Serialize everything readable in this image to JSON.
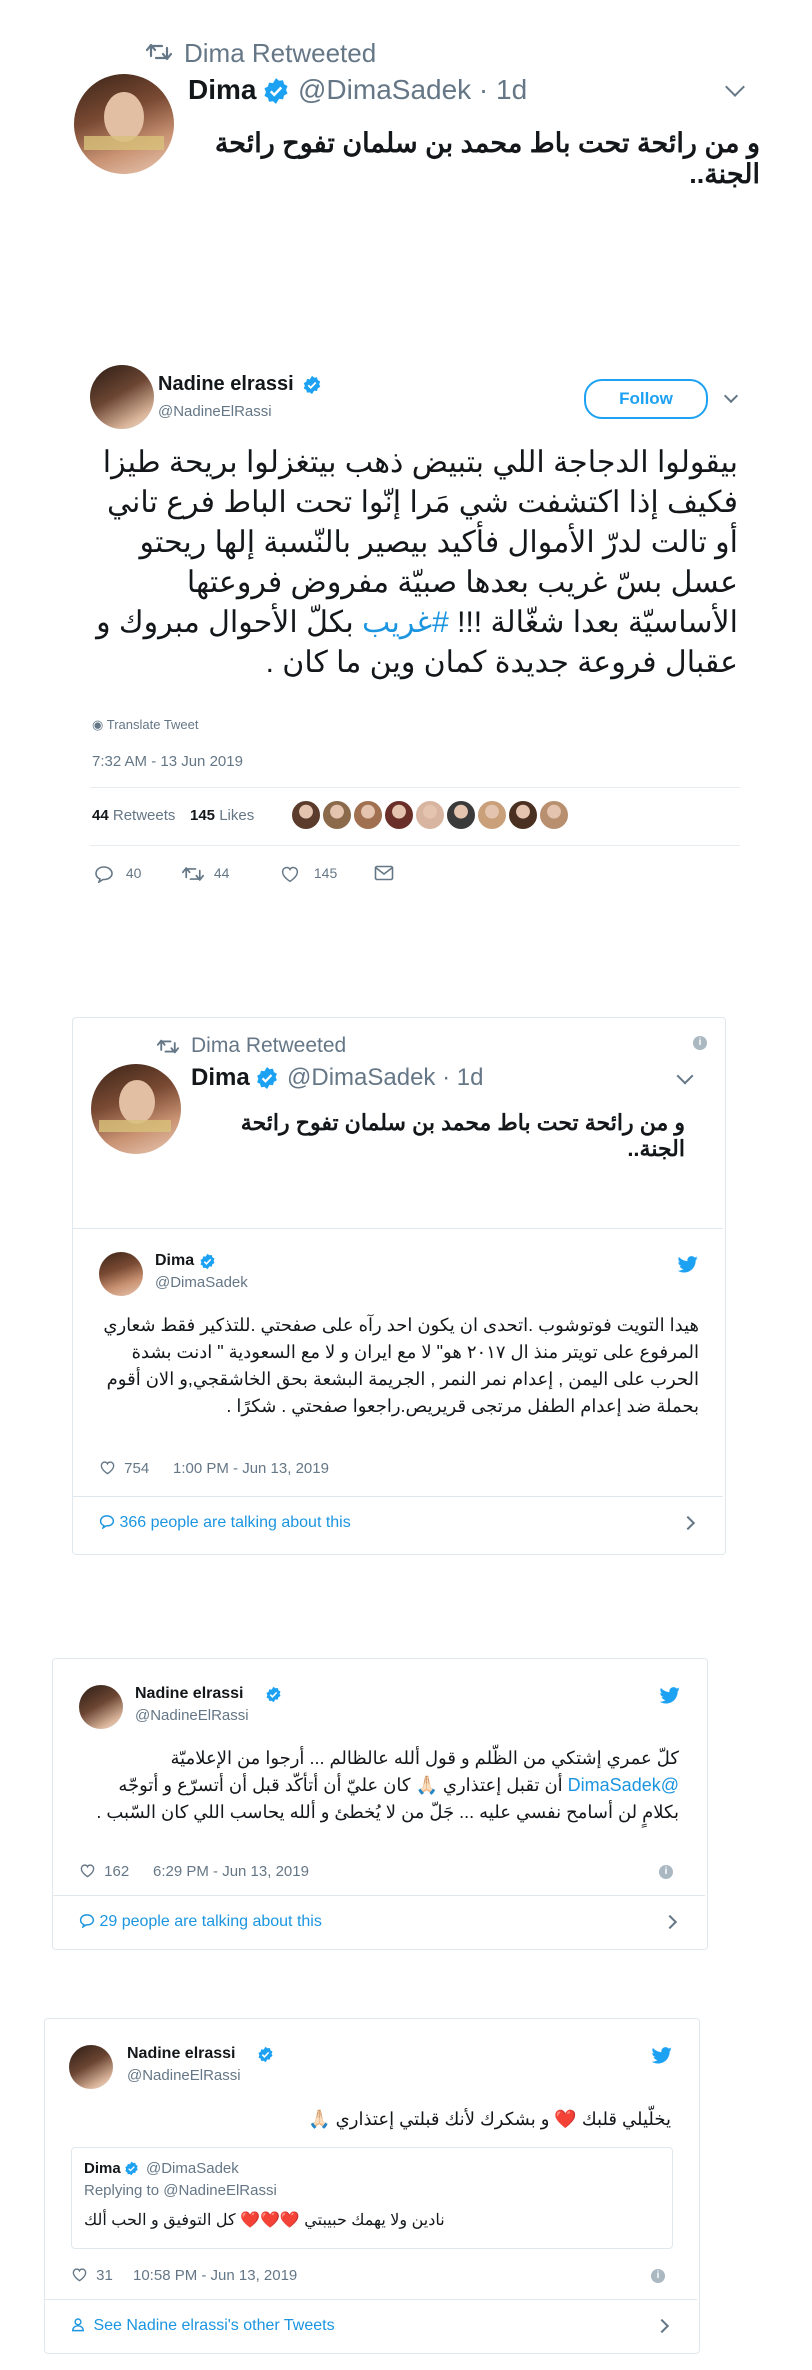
{
  "retweet1": {
    "retweeted_label": "Dima Retweeted",
    "name": "Dima",
    "handle_time": "@DimaSadek · 1d",
    "text": "و من رائحة تحت باط محمد بن سلمان تفوح رائحة الجنة.."
  },
  "tweet1": {
    "name": "Nadine elrassi",
    "handle": "@NadineElRassi",
    "follow_label": "Follow",
    "text_before_tag": "بيقولوا الدجاجة اللي بتبيض ذهب بيتغزلوا بريحة طيزا فكيف إذا اكتشفت شي مَرا إنّوا تحت الباط فرع تاني أو تالت لدرّ الأموال فأكيد بيصير بالنّسبة إلها ريحتو عسل بسّ غريب بعدها صبيّة مفروض فروعتها الأساسيّة بعدا شغّالة !!! ",
    "hashtag": "#غريب",
    "text_after_tag": " بكلّ الأحوال مبروك و عقبال فروعة جديدة كمان وين ما كان .",
    "translate": "Translate Tweet",
    "timestamp": "7:32 AM - 13 Jun 2019",
    "retweets_count": "44",
    "retweets_label": "Retweets",
    "likes_count": "145",
    "likes_label": "Likes",
    "replies": "40",
    "retweets": "44",
    "likes": "145",
    "liker_colors": [
      "#5a3b2c",
      "#8a6a4a",
      "#a07050",
      "#6b2f2a",
      "#d8b5a0",
      "#3a3a3a",
      "#c9a07a",
      "#4a3020",
      "#b89070"
    ]
  },
  "embed1": {
    "retweet": {
      "retweeted_label": "Dima Retweeted",
      "name": "Dima",
      "handle_time": "@DimaSadek · 1d",
      "text": "و من رائحة تحت باط محمد بن سلمان تفوح رائحة الجنة.."
    },
    "name": "Dima",
    "handle": "@DimaSadek",
    "text": "هيدا التويت فوتوشوب .اتحدى ان يكون احد رآه على صفحتي .للتذكير فقط شعاري المرفوع على تويتر منذ ال ٢٠١٧ هو\" لا مع ايران و لا مع السعودية \" ادنت بشدة الحرب على اليمن , إعدام نمر النمر , الجريمة البشعة بحق الخاشقجي,و الان أقوم بحملة ضد إعدام الطفل مرتجى قريريص.راجعوا صفحتي . شكرًا .",
    "likes": "754",
    "timestamp": "1:00 PM - Jun 13, 2019",
    "talking": "366 people are talking about this"
  },
  "embed2": {
    "name": "Nadine elrassi",
    "handle": "@NadineElRassi",
    "text_part1": "كلّ عمري إشتكي من الظّلم و قول ألله عالظالم ... أرجوا من الإعلاميّة ",
    "mention": "@DimaSadek",
    "text_part2": " أن تقبل إعتذاري 🙏🏻 كان عليّ أن أتأكّد قبل أن أتسرّع و أتوجّه بكلامٍ لن أسامح نفسي عليه ... جَلّ من لا يُخطئ و ألله يحاسب اللي كان السّبب .",
    "likes": "162",
    "timestamp": "6:29 PM - Jun 13, 2019",
    "talking": "29 people are talking about this"
  },
  "embed3": {
    "name": "Nadine elrassi",
    "handle": "@NadineElRassi",
    "text": "يخلّيلي قلبك ❤️ و بشكرك لأنك قبلتي إعتذاري 🙏🏻",
    "quote": {
      "name": "Dima",
      "handle": "@DimaSadek",
      "replying": "Replying to @NadineElRassi",
      "text": "نادين ولا يهمك حبيبتي ❤️❤️❤️ كل التوفيق و الحب ألك"
    },
    "likes": "31",
    "timestamp": "10:58 PM - Jun 13, 2019",
    "see_more": "See Nadine elrassi's other Tweets"
  },
  "colors": {
    "twitter_blue": "#1da1f2",
    "link_blue": "#1b95e0",
    "muted": "#657786",
    "border": "#e1e8ed"
  }
}
